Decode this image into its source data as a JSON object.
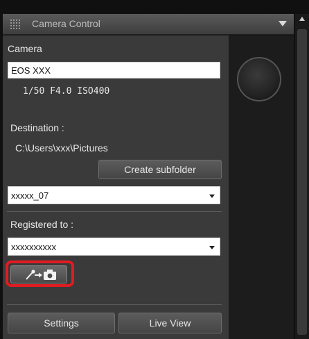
{
  "window": {
    "title": "Camera Control"
  },
  "camera": {
    "label": "Camera",
    "model": "EOS XXX",
    "settings_line": "1/50  F4.0  ISO400"
  },
  "destination": {
    "label": "Destination :",
    "path": "C:\\Users\\xxx\\Pictures",
    "create_subfolder_label": "Create subfolder",
    "subfolder_value": "xxxxx_07"
  },
  "registration": {
    "label": "Registered to :",
    "value": "xxxxxxxxxx"
  },
  "tool": {
    "icon": "eyedropper-to-camera-icon"
  },
  "footer": {
    "settings_label": "Settings",
    "live_view_label": "Live View"
  },
  "colors": {
    "panel_bg": "#3a3a3a",
    "highlight": "#e11b22"
  }
}
